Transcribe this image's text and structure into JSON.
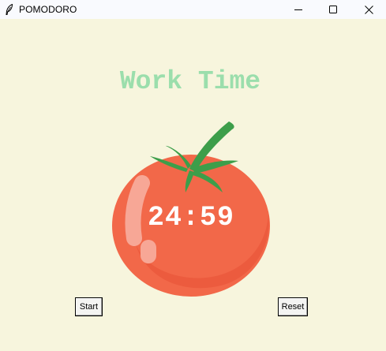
{
  "window": {
    "title": "POMODORO",
    "app_icon": "feather-icon",
    "controls": [
      "minimize-icon",
      "maximize-icon",
      "close-icon"
    ]
  },
  "main": {
    "heading": "Work Time",
    "timer": "24:59",
    "start_label": "Start",
    "reset_label": "Reset"
  },
  "colors": {
    "background": "#f7f5dd",
    "heading": "#9bdeac",
    "tomato": "#f26849",
    "leaves": "#3d9e4a",
    "timer_text": "#ffffff"
  }
}
